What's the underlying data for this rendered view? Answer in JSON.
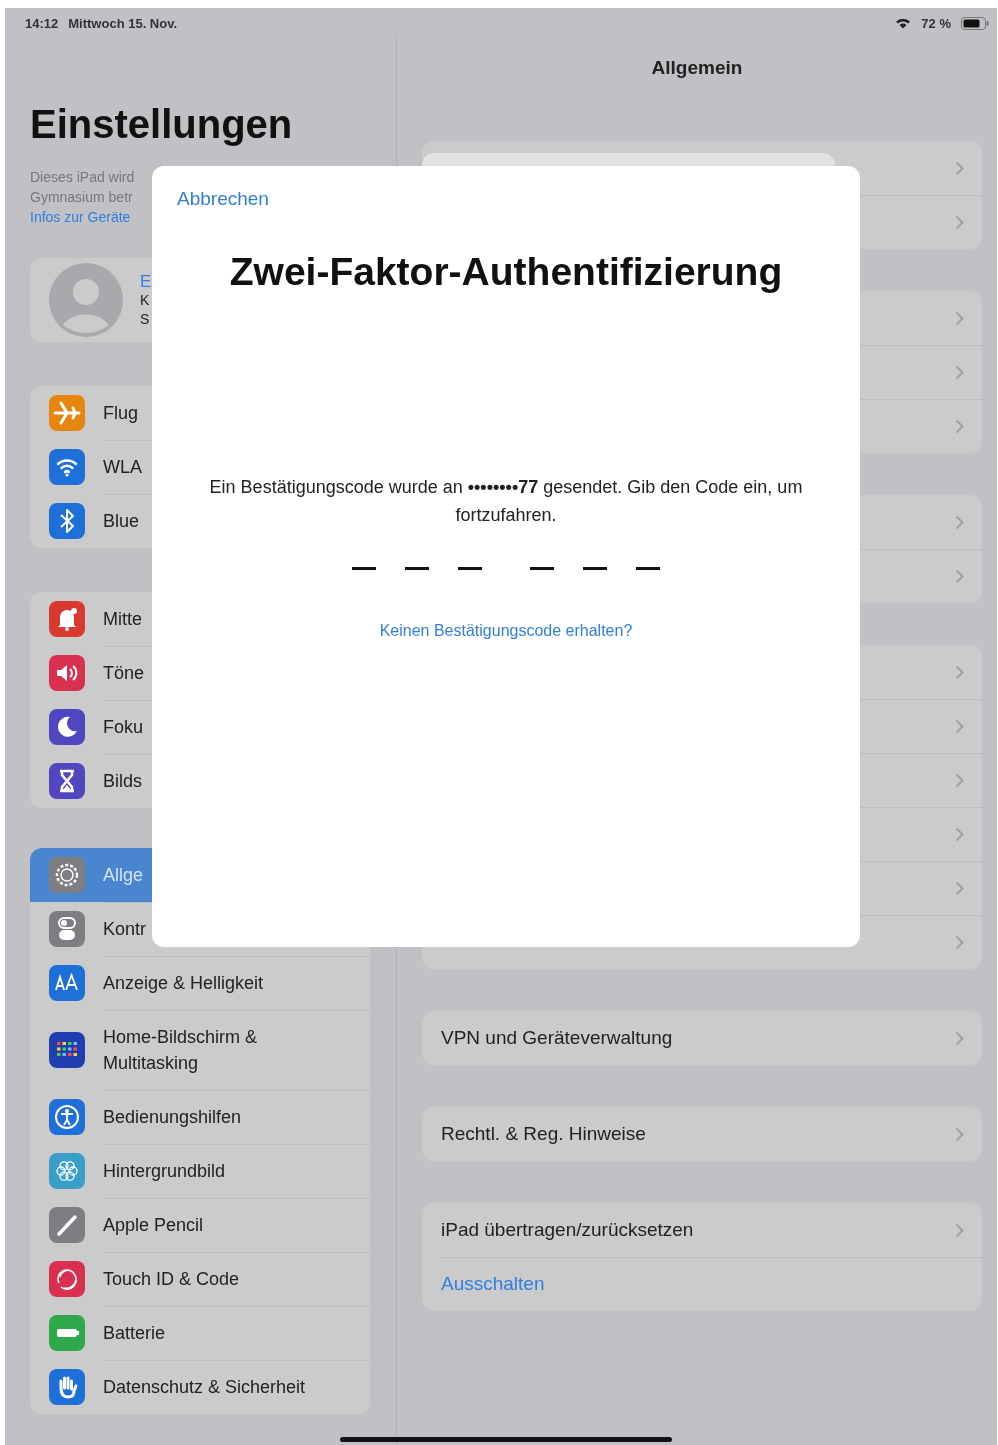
{
  "status_bar": {
    "time": "14:12",
    "date": "Mittwoch 15. Nov.",
    "battery": "72 %"
  },
  "sidebar": {
    "title": "Einstellungen",
    "description": {
      "line_1": "Dieses iPad wird",
      "line_2": "Gymnasium betr",
      "link": "Infos zur Geräte"
    },
    "profile": {
      "name": "E",
      "line_2": "K",
      "line_3": "S"
    },
    "groups": [
      {
        "items": [
          {
            "label": "Flug",
            "color": "#e8850f",
            "selected": false
          },
          {
            "label": "WLA",
            "color": "#1f6fd8",
            "selected": false
          },
          {
            "label": "Blue",
            "color": "#1f6fd8",
            "selected": false
          }
        ]
      },
      {
        "items": [
          {
            "label": "Mitte",
            "color": "#d93a2f",
            "selected": false
          },
          {
            "label": "Töne",
            "color": "#d9304f",
            "selected": false
          },
          {
            "label": "Foku",
            "color": "#5047c0",
            "selected": false
          },
          {
            "label": "Bilds",
            "color": "#5047c0",
            "selected": false
          }
        ]
      },
      {
        "items": [
          {
            "label": "Allge",
            "color": "#7d7d82",
            "selected": true
          },
          {
            "label": "Kontr",
            "color": "#7d7d82",
            "selected": false
          },
          {
            "label": "Anzeige & Helligkeit",
            "color": "#1f6fd8",
            "selected": false
          },
          {
            "label": "Home-Bildschirm & Multitasking",
            "color": "#1f3fb0",
            "selected": false
          },
          {
            "label": "Bedienungshilfen",
            "color": "#1f6fd8",
            "selected": false
          },
          {
            "label": "Hintergrundbild",
            "color": "#3a9fc8",
            "selected": false
          },
          {
            "label": "Apple Pencil",
            "color": "#7d7d82",
            "selected": false
          },
          {
            "label": "Touch ID & Code",
            "color": "#d9304f",
            "selected": false
          },
          {
            "label": "Batterie",
            "color": "#2ea84a",
            "selected": false
          },
          {
            "label": "Datenschutz & Sicherheit",
            "color": "#1f6fd8",
            "selected": false
          }
        ]
      }
    ]
  },
  "detail": {
    "title": "Allgemein",
    "groups": [
      {
        "rows": [
          {
            "kind": "chevron"
          },
          {
            "kind": "chevron"
          }
        ]
      },
      {
        "rows": [
          {
            "kind": "chevron"
          },
          {
            "kind": "chevron"
          },
          {
            "kind": "chevron"
          }
        ]
      },
      {
        "rows": [
          {
            "kind": "chevron"
          },
          {
            "kind": "chevron"
          }
        ]
      },
      {
        "rows": [
          {
            "kind": "chevron"
          },
          {
            "kind": "chevron"
          },
          {
            "kind": "chevron"
          },
          {
            "kind": "chevron"
          },
          {
            "kind": "chevron"
          },
          {
            "kind": "chevron"
          }
        ]
      },
      {
        "rows": [
          {
            "kind": "chevron",
            "label": "VPN und Geräteverwaltung"
          }
        ]
      },
      {
        "rows": [
          {
            "kind": "chevron",
            "label": "Rechtl. & Reg. Hinweise"
          }
        ]
      },
      {
        "rows": [
          {
            "kind": "chevron",
            "label": "iPad übertragen/zurücksetzen"
          },
          {
            "kind": "action",
            "label": "Ausschalten"
          }
        ]
      }
    ]
  },
  "dialog": {
    "cancel": "Abbrechen",
    "title": "Zwei-Faktor-Authentifizierung",
    "message": "Ein Bestätigungscode wurde an **••••••••77** gesendet. Gib den Code ein, um fortzufahren.",
    "code_slots": [
      {
        "filled": false
      },
      {
        "filled": false
      },
      {
        "filled": false
      },
      {
        "filled": false
      },
      {
        "filled": false
      },
      {
        "filled": false
      }
    ],
    "help_link": "Keinen Bestätigungscode erhalten?"
  }
}
